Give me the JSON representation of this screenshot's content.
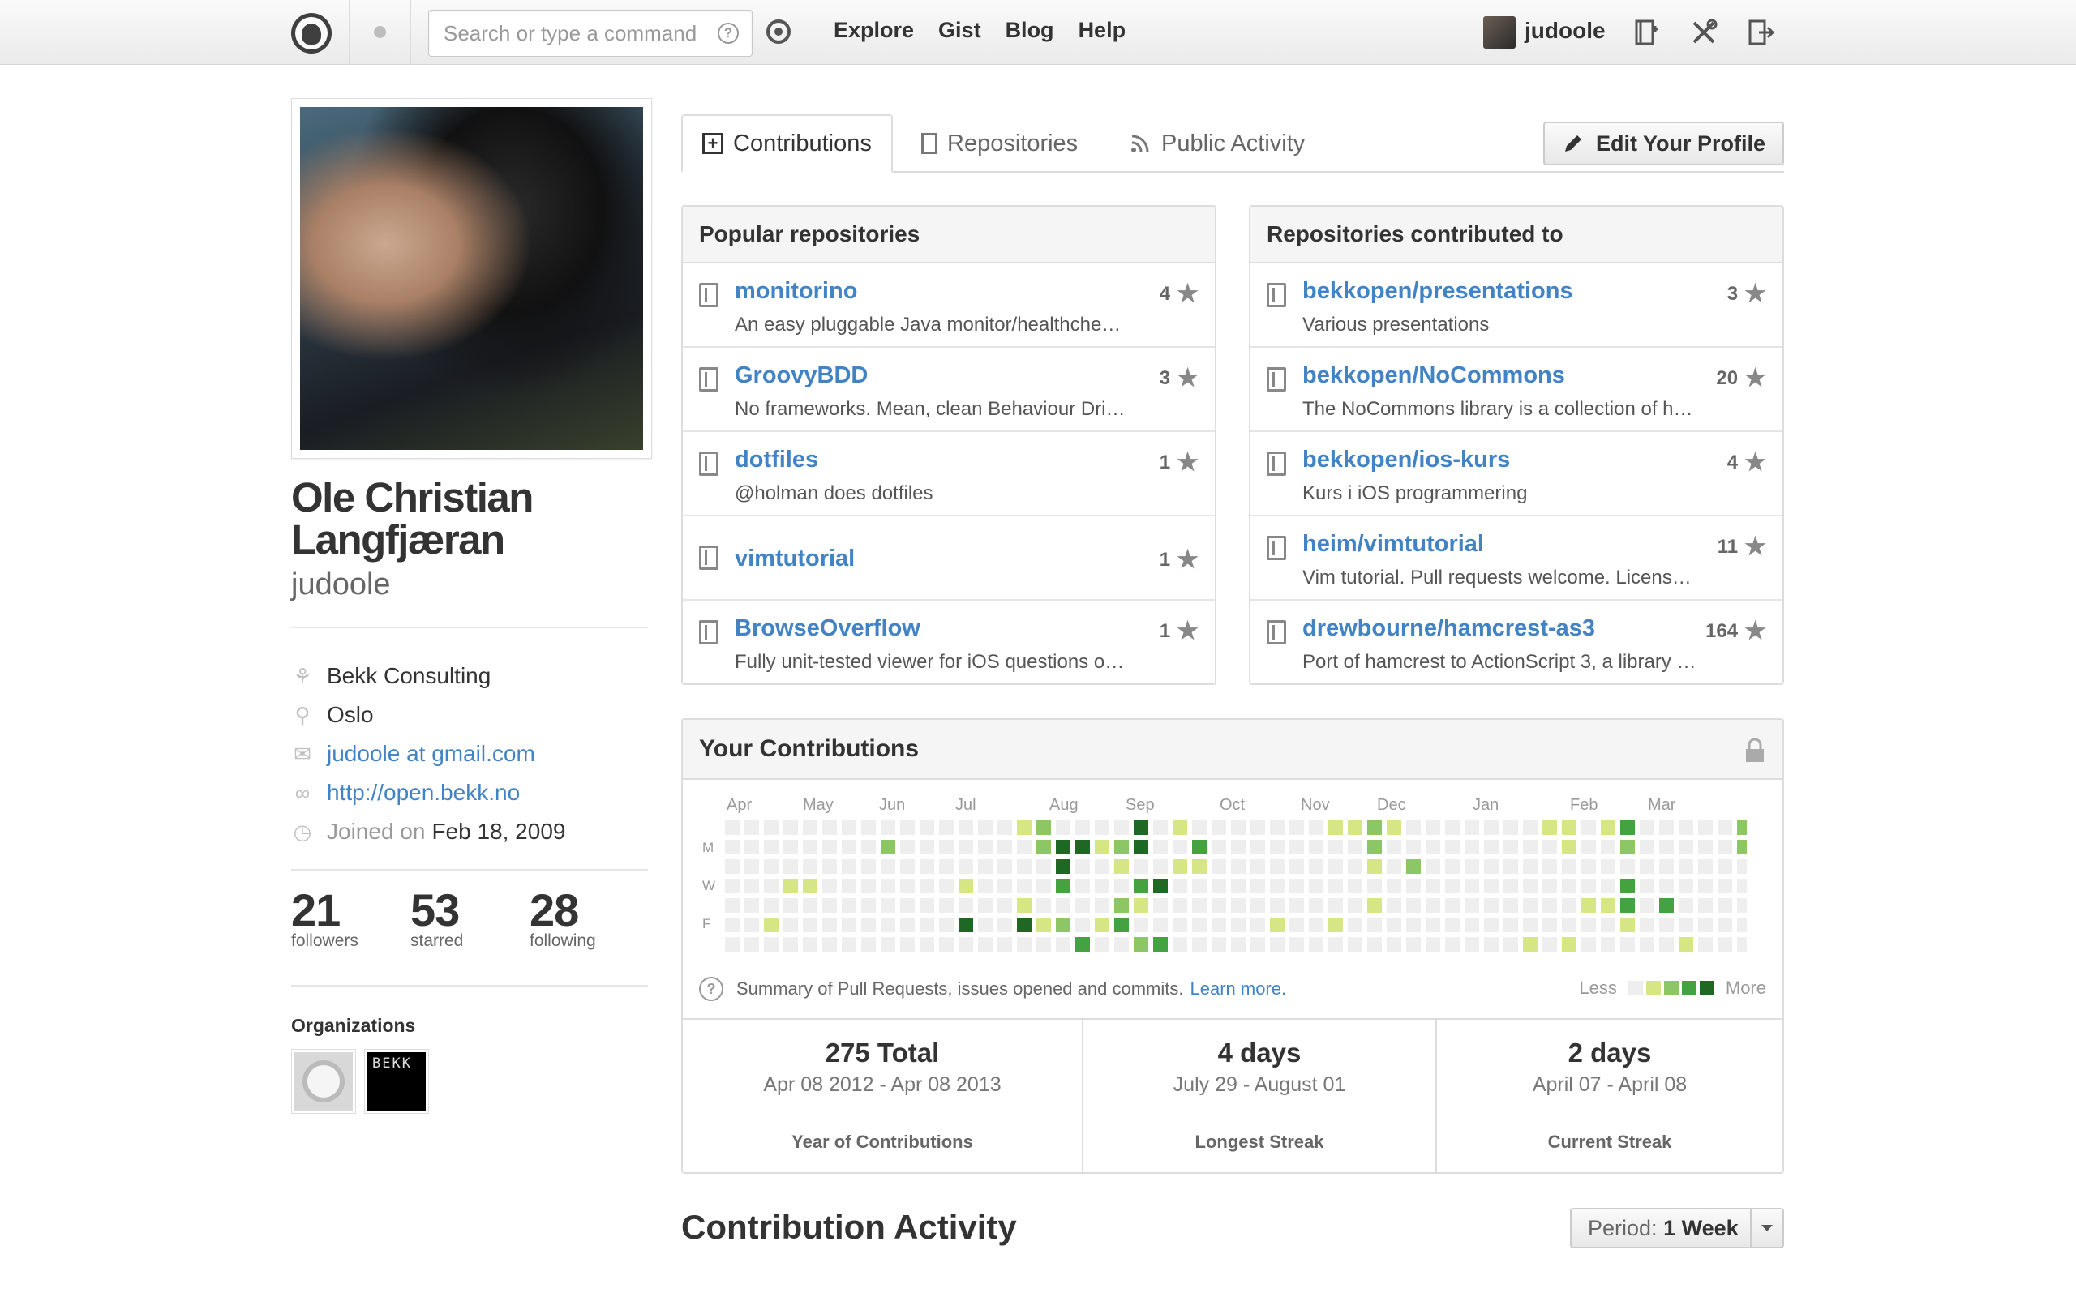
{
  "header": {
    "search_placeholder": "Search or type a command",
    "search_help": "?",
    "nav": [
      "Explore",
      "Gist",
      "Blog",
      "Help"
    ],
    "username": "judoole",
    "icons": [
      "octocat-logo-icon",
      "notifications-dot-icon",
      "gear-icon",
      "new-repo-icon",
      "settings-tools-icon",
      "sign-out-icon"
    ]
  },
  "profile": {
    "full_name": "Ole Christian Langfjæran",
    "login": "judoole",
    "company": "Bekk Consulting",
    "location": "Oslo",
    "email": "judoole at gmail.com",
    "website": "http://open.bekk.no",
    "joined_label": "Joined on",
    "joined_date": "Feb 18, 2009",
    "stats": [
      {
        "num": "21",
        "label": "followers"
      },
      {
        "num": "53",
        "label": "starred"
      },
      {
        "num": "28",
        "label": "following"
      }
    ],
    "organizations_title": "Organizations",
    "org_bekk_text": "BEKK"
  },
  "tabs": {
    "contributions": "Contributions",
    "repositories": "Repositories",
    "public_activity": "Public Activity",
    "edit_profile": "Edit Your Profile"
  },
  "popular": {
    "title": "Popular repositories",
    "repos": [
      {
        "name": "monitorino",
        "desc": "An easy pluggable Java monitor/healthche…",
        "stars": "4"
      },
      {
        "name": "GroovyBDD",
        "desc": "No frameworks. Mean, clean Behaviour Dri…",
        "stars": "3"
      },
      {
        "name": "dotfiles",
        "desc": "@holman does dotfiles",
        "stars": "1"
      },
      {
        "name": "vimtutorial",
        "desc": "",
        "stars": "1"
      },
      {
        "name": "BrowseOverflow",
        "desc": "Fully unit-tested viewer for iOS questions o…",
        "stars": "1"
      }
    ]
  },
  "contributed": {
    "title": "Repositories contributed to",
    "repos": [
      {
        "name": "bekkopen/presentations",
        "desc": "Various presentations",
        "stars": "3"
      },
      {
        "name": "bekkopen/NoCommons",
        "desc": "The NoCommons library is a collection of h…",
        "stars": "20"
      },
      {
        "name": "bekkopen/ios-kurs",
        "desc": "Kurs i iOS programmering",
        "stars": "4"
      },
      {
        "name": "heim/vimtutorial",
        "desc": "Vim tutorial. Pull requests welcome. Licens…",
        "stars": "11"
      },
      {
        "name": "drewbourne/hamcrest-as3",
        "desc": "Port of hamcrest to ActionScript 3, a library …",
        "stars": "164"
      }
    ]
  },
  "contributions": {
    "title": "Your Contributions",
    "months": [
      "Apr",
      "May",
      "Jun",
      "Jul",
      "Aug",
      "Sep",
      "Oct",
      "Nov",
      "Dec",
      "Jan",
      "Feb",
      "Mar"
    ],
    "day_labels": [
      "M",
      "W",
      "F"
    ],
    "footer_text": "Summary of Pull Requests, issues opened and commits.",
    "learn_more": "Learn more.",
    "less": "Less",
    "more": "More",
    "colors": [
      "#eeeeee",
      "#d6e685",
      "#8cc665",
      "#44a340",
      "#1e6823"
    ],
    "total": {
      "big": "275 Total",
      "range": "Apr 08 2012 - Apr 08 2013",
      "caption": "Year of Contributions"
    },
    "longest": {
      "big": "4 days",
      "range": "July 29 - August 01",
      "caption": "Longest Streak"
    },
    "current": {
      "big": "2 days",
      "range": "April 07 - April 08",
      "caption": "Current Streak"
    }
  },
  "activity": {
    "title": "Contribution Activity",
    "period_label": "Period:",
    "period_value": "1 Week"
  }
}
